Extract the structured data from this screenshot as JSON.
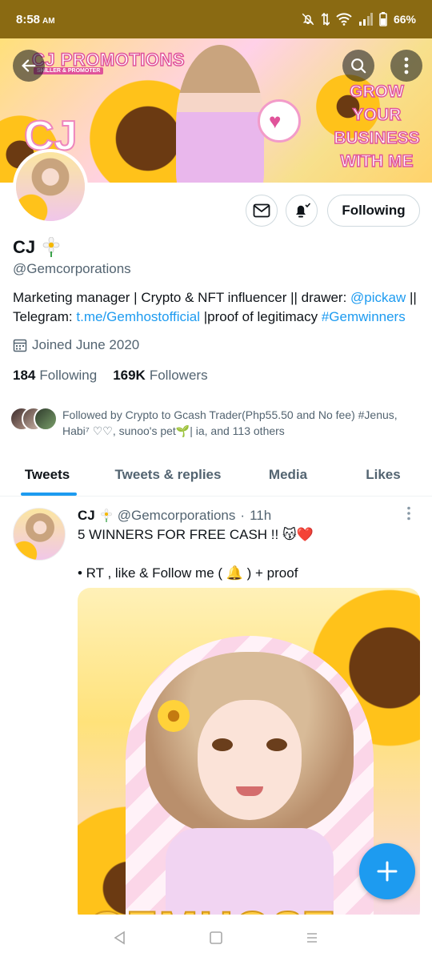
{
  "status": {
    "time": "8:58",
    "ampm": "AM",
    "battery": "66%"
  },
  "banner": {
    "title": "CJ PROMOTIONS",
    "subtitle": "SHILLER & PROMOTER",
    "cta_lines": [
      "GROW",
      "YOUR",
      "BUSINESS",
      "WITH ME"
    ],
    "monogram": "CJ"
  },
  "profile": {
    "name": "CJ",
    "handle": "@Gemcorporations",
    "bio_prefix": "Marketing manager | Crypto & NFT influencer || drawer: ",
    "bio_mention": "@pickaw",
    "bio_mid": " || Telegram: ",
    "bio_link": "t.me/Gemhostofficial",
    "bio_mid2": " |proof of legitimacy ",
    "bio_hashtag": "#Gemwinners",
    "joined": "Joined June 2020",
    "following_count": "184",
    "following_label": "Following",
    "followers_count": "169K",
    "followers_label": "Followers",
    "followed_by": "Followed by Crypto to Gcash Trader(Php55.50 and No fee) #Jenus, Habi⁷ ♡♡, sunoo's pet🌱| ia, and 113 others"
  },
  "buttons": {
    "following": "Following"
  },
  "tabs": [
    "Tweets",
    "Tweets & replies",
    "Media",
    "Likes"
  ],
  "tweet": {
    "name": "CJ",
    "handle": "@Gemcorporations",
    "dot": "·",
    "time": "11h",
    "line1": "5 WINNERS FOR FREE CASH !! 😽❤️",
    "line2": "• RT , like & Follow me ( 🔔 ) + proof",
    "image_text": "GEMHOST"
  },
  "colors": {
    "accent": "#1d9bf0",
    "status_bar": "#8a6a12",
    "banner_pink": "#e0539a"
  },
  "icons": [
    "back-arrow-icon",
    "search-icon",
    "more-vertical-icon",
    "mail-icon",
    "bell-icon",
    "calendar-icon",
    "sunflower-icon",
    "compose-plus-icon"
  ]
}
